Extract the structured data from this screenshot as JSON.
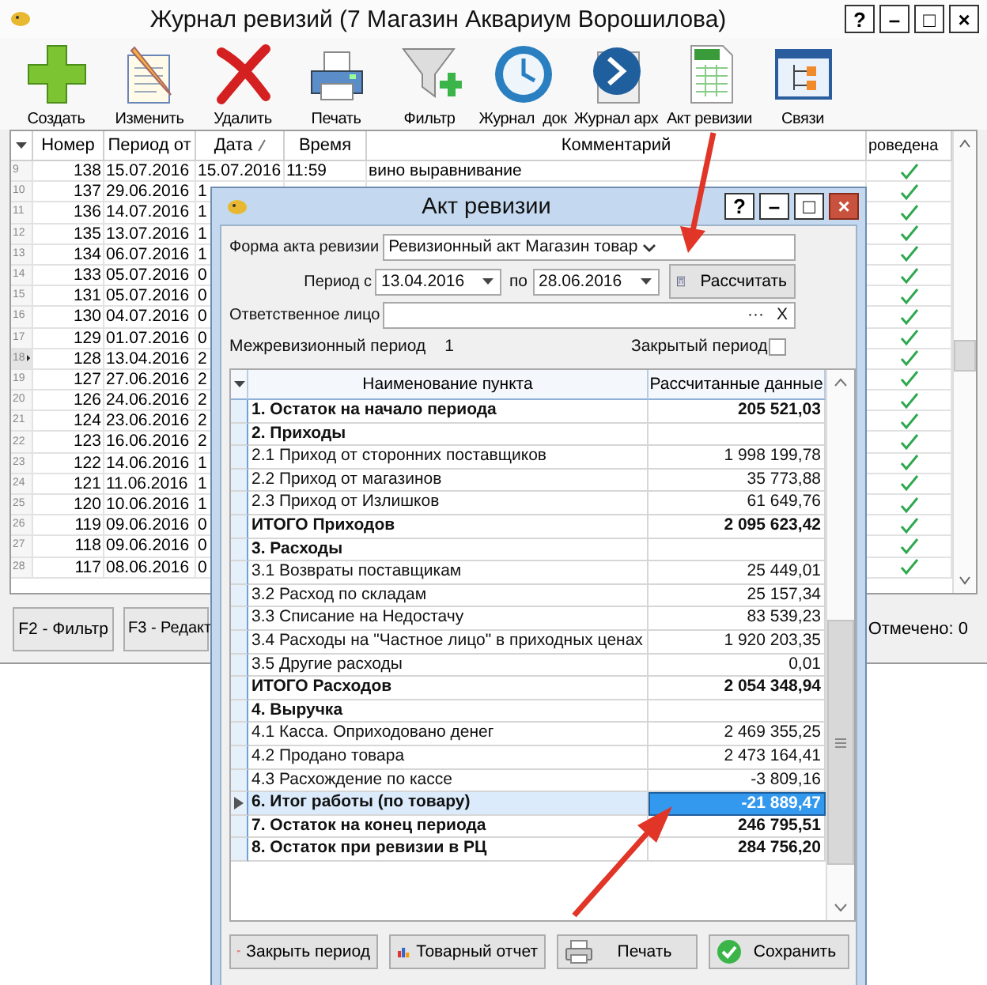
{
  "main_window": {
    "title": "Журнал ревизий (7 Магазин Аквариум Ворошилова)",
    "window_buttons": [
      "?",
      "–",
      "□",
      "×"
    ],
    "toolbar": [
      "Создать",
      "Изменить",
      "Удалить",
      "Печать",
      "Фильтр",
      "Журнал  док",
      "Журнал арх",
      "Акт ревизии",
      "Связи"
    ],
    "journal": {
      "columns": [
        {
          "label": "Номер",
          "sorted": false
        },
        {
          "label": "Период от",
          "sorted": false
        },
        {
          "label": "Дата",
          "sorted": true
        },
        {
          "label": "Время",
          "sorted": false
        },
        {
          "label": "Комментарий",
          "sorted": false
        },
        {
          "label": "роведена",
          "sorted": false
        }
      ],
      "rows": [
        {
          "row_number": "9",
          "number": "138",
          "period_from": "15.07.2016",
          "date": "15.07.2016",
          "time": "11:59",
          "comment": "вино выравнивание",
          "posted": true,
          "selected": false
        },
        {
          "row_number": "10",
          "number": "137",
          "period_from": "29.06.2016",
          "date": "1",
          "posted": true,
          "selected": false
        },
        {
          "row_number": "11",
          "number": "136",
          "period_from": "14.07.2016",
          "date": "1",
          "posted": true,
          "selected": false
        },
        {
          "row_number": "12",
          "number": "135",
          "period_from": "13.07.2016",
          "date": "1",
          "posted": true,
          "selected": false
        },
        {
          "row_number": "13",
          "number": "134",
          "period_from": "06.07.2016",
          "date": "1",
          "posted": true,
          "selected": false
        },
        {
          "row_number": "14",
          "number": "133",
          "period_from": "05.07.2016",
          "date": "0",
          "posted": true,
          "selected": false
        },
        {
          "row_number": "15",
          "number": "131",
          "period_from": "05.07.2016",
          "date": "0",
          "posted": true,
          "selected": false
        },
        {
          "row_number": "16",
          "number": "130",
          "period_from": "04.07.2016",
          "date": "0",
          "posted": true,
          "selected": false
        },
        {
          "row_number": "17",
          "number": "129",
          "period_from": "01.07.2016",
          "date": "0",
          "posted": true,
          "selected": false
        },
        {
          "row_number": "18",
          "number": "128",
          "period_from": "13.04.2016",
          "date": "2",
          "posted": true,
          "selected": true
        },
        {
          "row_number": "19",
          "number": "127",
          "period_from": "27.06.2016",
          "date": "2",
          "posted": true,
          "selected": false
        },
        {
          "row_number": "20",
          "number": "126",
          "period_from": "24.06.2016",
          "date": "2",
          "posted": true,
          "selected": false
        },
        {
          "row_number": "21",
          "number": "124",
          "period_from": "23.06.2016",
          "date": "2",
          "posted": true,
          "selected": false
        },
        {
          "row_number": "22",
          "number": "123",
          "period_from": "16.06.2016",
          "date": "2",
          "posted": true,
          "selected": false
        },
        {
          "row_number": "23",
          "number": "122",
          "period_from": "14.06.2016",
          "date": "1",
          "posted": true,
          "selected": false
        },
        {
          "row_number": "24",
          "number": "121",
          "period_from": "11.06.2016",
          "date": "1",
          "posted": true,
          "selected": false
        },
        {
          "row_number": "25",
          "number": "120",
          "period_from": "10.06.2016",
          "date": "1",
          "posted": true,
          "selected": false
        },
        {
          "row_number": "26",
          "number": "119",
          "period_from": "09.06.2016",
          "date": "0",
          "posted": true,
          "selected": false
        },
        {
          "row_number": "27",
          "number": "118",
          "period_from": "09.06.2016",
          "date": "0",
          "posted": true,
          "selected": false
        },
        {
          "row_number": "28",
          "number": "117",
          "period_from": "08.06.2016",
          "date": "0",
          "posted": true,
          "selected": false
        }
      ]
    },
    "footer": {
      "buttons": [
        "F2 - Фильтр",
        "F3 - Редакт"
      ],
      "status": "Отмечено: 0"
    }
  },
  "dialog": {
    "title": "Акт ревизии",
    "window_buttons": [
      "?",
      "–",
      "□",
      "×"
    ],
    "form": {
      "form_label": "Форма акта ревизии",
      "form_value": "Ревизионный акт Магазин товар",
      "period_label": "Период  с",
      "date_from": "13.04.2016",
      "to_label": "по",
      "date_to": "28.06.2016",
      "calculate_button": "Рассчитать",
      "person_label": "Ответственное лицо",
      "browse_button": "···",
      "clear_button": "X",
      "interval_label": "Межревизионный период",
      "interval_value": "1",
      "closed_label": "Закрытый период",
      "closed_checked": false
    },
    "table": {
      "columns": [
        "Наименование пункта",
        "Рассчитанные данные"
      ],
      "rows": [
        {
          "name": "1. Остаток на начало периода",
          "value": "205 521,03",
          "bold": true,
          "selected": false
        },
        {
          "name": "2. Приходы",
          "bold": true,
          "selected": false
        },
        {
          "name": "2.1 Приход от сторонних поставщиков",
          "value": "1 998 199,78",
          "bold": false,
          "selected": false
        },
        {
          "name": "2.2 Приход от магазинов",
          "value": "35 773,88",
          "bold": false,
          "selected": false
        },
        {
          "name": "2.3 Приход от Излишков",
          "value": "61 649,76",
          "bold": false,
          "selected": false
        },
        {
          "name": "ИТОГО Приходов",
          "value": "2 095 623,42",
          "bold": true,
          "selected": false
        },
        {
          "name": "3. Расходы",
          "bold": true,
          "selected": false
        },
        {
          "name": "3.1 Возвраты поставщикам",
          "value": "25 449,01",
          "bold": false,
          "selected": false
        },
        {
          "name": "3.2 Расход по складам",
          "value": "25 157,34",
          "bold": false,
          "selected": false
        },
        {
          "name": "3.3 Списание на Недостачу",
          "value": "83 539,23",
          "bold": false,
          "selected": false
        },
        {
          "name": "3.4 Расходы на \"Частное лицо\" в приходных ценах",
          "value": "1 920 203,35",
          "bold": false,
          "selected": false
        },
        {
          "name": "3.5 Другие расходы",
          "value": "0,01",
          "bold": false,
          "selected": false
        },
        {
          "name": "ИТОГО Расходов",
          "value": "2 054 348,94",
          "bold": true,
          "selected": false
        },
        {
          "name": "4. Выручка",
          "bold": true,
          "selected": false
        },
        {
          "name": "4.1 Касса. Оприходовано денег",
          "value": "2 469 355,25",
          "bold": false,
          "selected": false
        },
        {
          "name": "4.2 Продано товара",
          "value": "2 473 164,41",
          "bold": false,
          "selected": false
        },
        {
          "name": "4.3 Расхождение по кассе",
          "value": "-3 809,16",
          "bold": false,
          "selected": false
        },
        {
          "name": "6. Итог работы (по товару)",
          "value": "-21 889,47",
          "bold": true,
          "selected": true
        },
        {
          "name": "7. Остаток на конец периода",
          "value": "246 795,51",
          "bold": true,
          "selected": false
        },
        {
          "name": "8. Остаток при ревизии в РЦ",
          "value": "284 756,20",
          "bold": true,
          "selected": false
        }
      ]
    },
    "buttons": [
      "Закрыть период",
      "Товарный отчет",
      "Печать",
      "Сохранить"
    ]
  }
}
